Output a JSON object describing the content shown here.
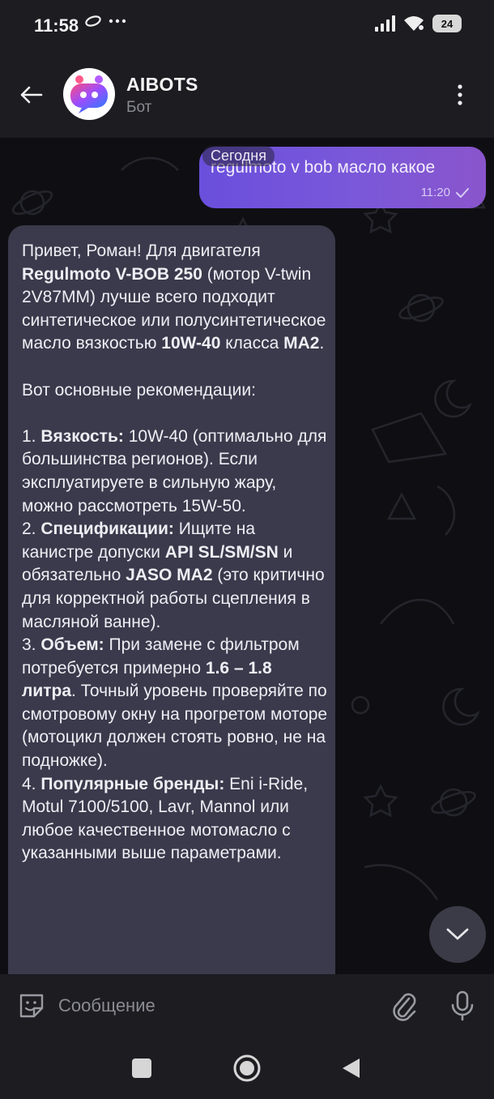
{
  "status_bar": {
    "time": "11:58",
    "battery": "24"
  },
  "header": {
    "title": "AIBOTS",
    "subtitle": "Бот"
  },
  "chat": {
    "date_label": "Сегодня",
    "outgoing": {
      "text": "regulmoto v bob масло какое",
      "time": "11:20"
    },
    "incoming_paragraphs": [
      [
        {
          "t": "Привет, Роман! Для двигателя "
        },
        {
          "t": "Regulmoto V-BOB 250",
          "b": true
        },
        {
          "t": " (мотор V-twin 2V87MM) лучше всего подходит синтетическое или полусинтетическое масло вязкостью "
        },
        {
          "t": "10W-40",
          "b": true
        },
        {
          "t": " класса "
        },
        {
          "t": "MA2",
          "b": true
        },
        {
          "t": "."
        }
      ],
      [
        {
          "t": "Вот основные рекомендации:"
        }
      ],
      [
        {
          "t": "1. "
        },
        {
          "t": "Вязкость:",
          "b": true
        },
        {
          "t": " 10W-40 (оптимально для большинства регионов). Если эксплуатируете в сильную жару, можно рассмотреть 15W-50."
        }
      ],
      [
        {
          "t": "2. "
        },
        {
          "t": "Спецификации:",
          "b": true
        },
        {
          "t": " Ищите на канистре допуски "
        },
        {
          "t": "API SL/SM/SN",
          "b": true
        },
        {
          "t": " и обязательно "
        },
        {
          "t": "JASO MA2",
          "b": true
        },
        {
          "t": " (это критично для корректной работы сцепления в масляной ванне)."
        }
      ],
      [
        {
          "t": "3. "
        },
        {
          "t": "Объем:",
          "b": true
        },
        {
          "t": " При замене с фильтром потребуется примерно "
        },
        {
          "t": "1.6 – 1.8 литра",
          "b": true
        },
        {
          "t": ". Точный уровень проверяйте по смотровому окну на прогретом моторе (мотоцикл должен стоять ровно, не на подножке)."
        }
      ],
      [
        {
          "t": "4. "
        },
        {
          "t": "Популярные бренды:",
          "b": true
        },
        {
          "t": " Eni i-Ride, Motul 7100/5100, Lavr, Mannol или любое качественное мотомасло с указанными выше параметрами."
        }
      ]
    ],
    "gap_after": [
      0,
      1
    ]
  },
  "composer": {
    "placeholder": "Сообщение"
  },
  "colors": {
    "accent": "#7a58d9",
    "incoming_bubble": "#3a3a4c",
    "bar": "#1c1c21"
  }
}
